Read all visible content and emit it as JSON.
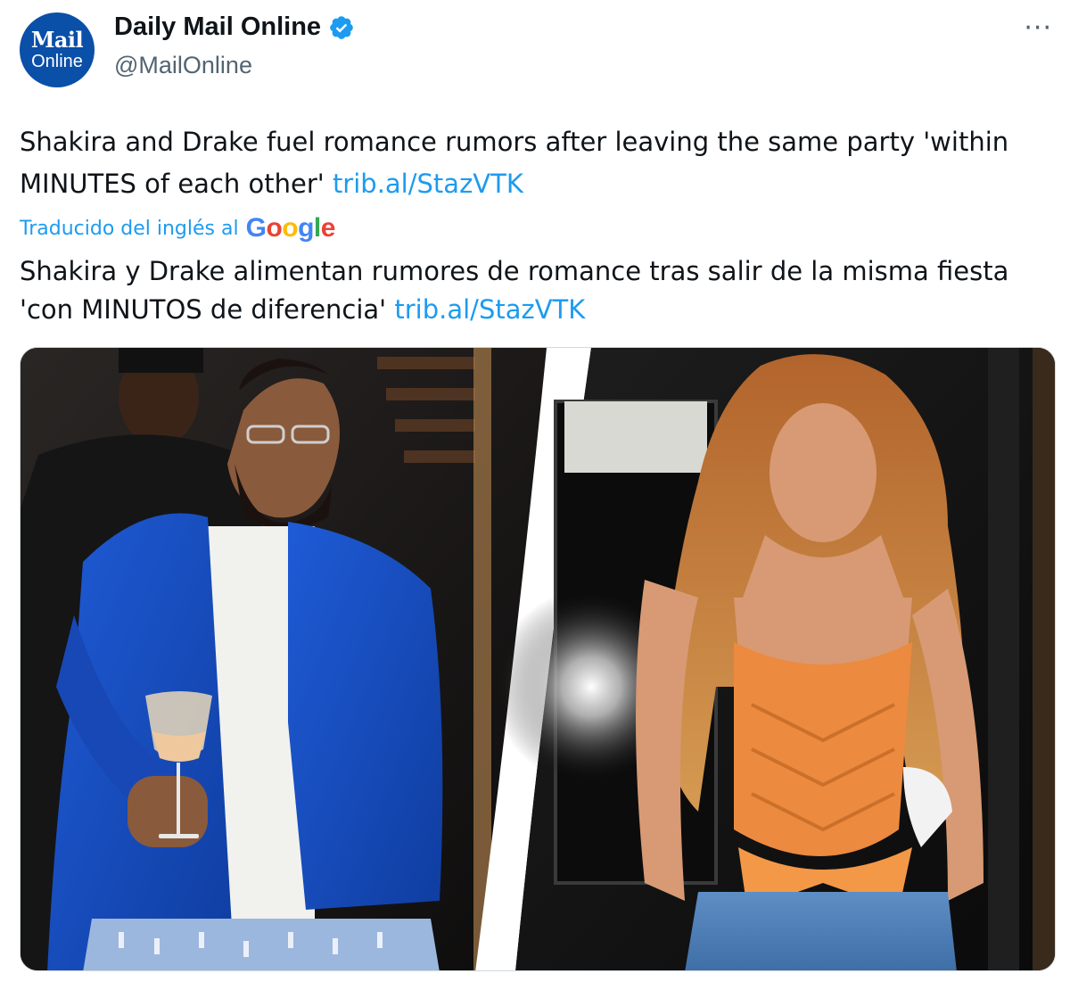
{
  "author": {
    "avatar_line1": "Mail",
    "avatar_line2": "Online",
    "name": "Daily Mail Online",
    "handle": "@MailOnline"
  },
  "tweet": {
    "text": "Shakira and Drake fuel romance rumors after leaving the same party 'within MINUTES of each other'",
    "link": "trib.al/StazVTK"
  },
  "translation": {
    "label": "Traducido del inglés al",
    "provider": "Google",
    "text": "Shakira y Drake alimentan rumores de romance tras salir de la misma fiesta 'con MINUTOS de diferencia'",
    "link": "trib.al/StazVTK"
  },
  "icons": {
    "verified": "verified-badge-icon",
    "more": "more-options-icon"
  },
  "colors": {
    "link": "#1d9bf0",
    "brand_avatar": "#0a4fa8",
    "verified": "#1d9bf0"
  }
}
